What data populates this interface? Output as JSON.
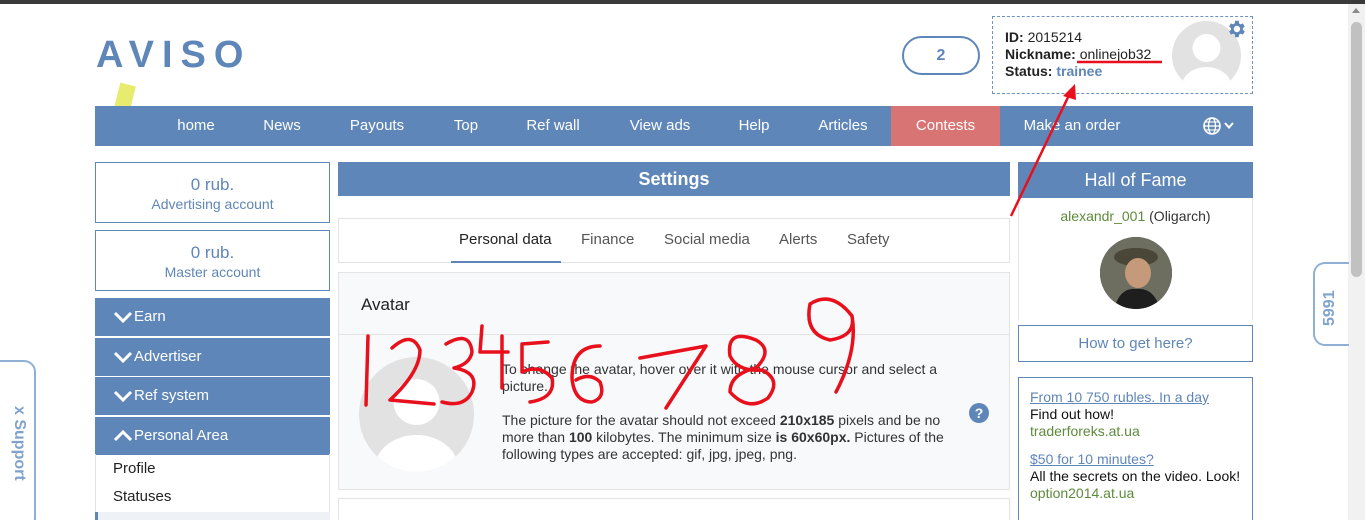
{
  "logo": "AVISO",
  "header": {
    "counter": "2",
    "profile": {
      "id_label": "ID:",
      "id_value": "2015214",
      "nickname_label": "Nickname:",
      "nickname_value": "onlinejob32",
      "status_label": "Status:",
      "status_value": "trainee",
      "settings_icon": "gear-icon"
    }
  },
  "nav": {
    "items": [
      "home",
      "News",
      "Payouts",
      "Top",
      "Ref wall",
      "View ads",
      "Help",
      "Articles",
      "Contests",
      "Make an order"
    ],
    "language_icon": "globe-icon"
  },
  "sidebar": {
    "advertising": {
      "amount": "0 rub.",
      "label": "Advertising account"
    },
    "master": {
      "amount": "0 rub.",
      "label": "Master account"
    },
    "sections": [
      "Earn",
      "Advertiser",
      "Ref system",
      "Personal Area"
    ],
    "personal_area_items": [
      "Profile",
      "Statuses"
    ]
  },
  "main": {
    "title": "Settings",
    "tabs": [
      "Personal data",
      "Finance",
      "Social media",
      "Alerts",
      "Safety"
    ],
    "active_tab": "Personal data",
    "avatar": {
      "title": "Avatar",
      "para1": "To change the avatar, hover over it with the mouse cursor and select a picture.",
      "para2": {
        "t1": "The picture for the avatar should not exceed ",
        "b1": "210x185",
        "t2": " pixels and be no more than ",
        "b2": "100",
        "t3": " kilobytes. The minimum size ",
        "b3": "is 60x60px.",
        "t4": " Pictures of the following types are accepted: gif, jpg, jpeg, png."
      },
      "help_icon": "?"
    }
  },
  "hall_of_fame": {
    "title": "Hall of Fame",
    "user": "alexandr_001",
    "role": "(Oligarch)",
    "howto": "How to get here?"
  },
  "ads": [
    {
      "link": "From 10 750 rubles. In a day",
      "text": "Find out how!",
      "site": "traderforeks.at.ua"
    },
    {
      "link": "$50 for 10 minutes?",
      "text": "All the secrets on the video. Look!",
      "site": "option2014.at.ua"
    }
  ],
  "side_tabs": {
    "count": "5991",
    "support": "x  Support"
  },
  "annotation": {
    "scribble": "123456789",
    "color": "#e8101c"
  },
  "colors": {
    "brand": "#5f86b8",
    "contests": "#d87474",
    "green": "#5e8a3c"
  }
}
